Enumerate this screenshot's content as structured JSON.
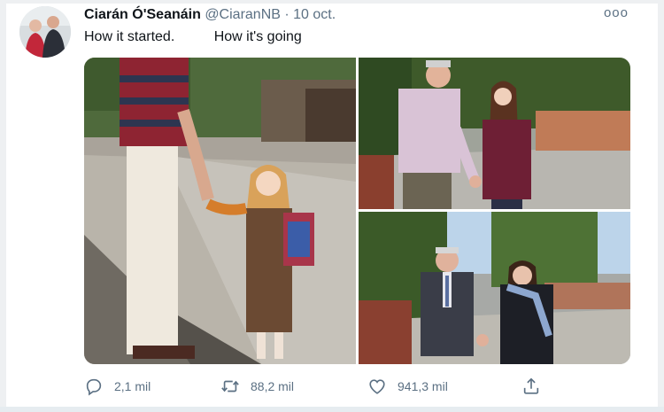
{
  "tweet": {
    "display_name": "Ciarán Ó'Seanáin",
    "handle": "@CiaranNB",
    "separator": "·",
    "date": "10 oct.",
    "more_icon": "ooo",
    "text": "How it started.          How it's going"
  },
  "media": {
    "photos": [
      {
        "name": "photo-how-it-started",
        "scene": "father-and-child-first-school-day"
      },
      {
        "name": "photo-how-it-going-handshake",
        "scene": "father-and-daughter-handshake-street"
      },
      {
        "name": "photo-how-it-going-graduation",
        "scene": "father-and-daughter-graduation-handshake"
      }
    ]
  },
  "actions": {
    "reply": {
      "icon": "reply-icon",
      "count": "2,1 mil"
    },
    "retweet": {
      "icon": "retweet-icon",
      "count": "88,2 mil"
    },
    "like": {
      "icon": "heart-icon",
      "count": "941,3 mil"
    },
    "share": {
      "icon": "share-icon"
    }
  },
  "colors": {
    "text": "#0f1419",
    "secondary": "#5b7083",
    "frame": "#eef0f2"
  }
}
